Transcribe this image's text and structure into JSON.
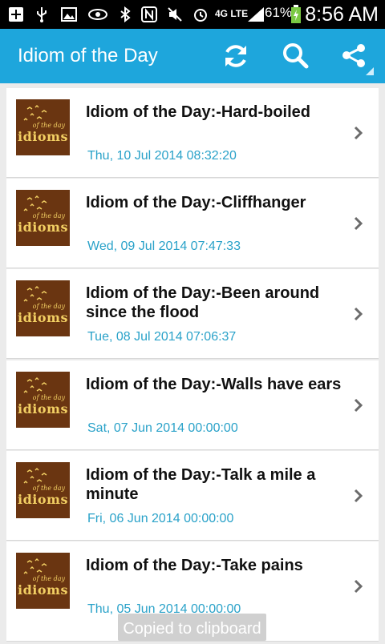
{
  "status_bar": {
    "battery": "61%",
    "network": "4G LTE",
    "time": "8:56 AM"
  },
  "app_bar": {
    "title": "Idiom of the Day",
    "icons": [
      "refresh-icon",
      "search-icon",
      "share-icon"
    ]
  },
  "thumbnail": {
    "logo_text": "idioms",
    "logo_subtext": "of the day"
  },
  "items": [
    {
      "title": "Idiom of the Day:-Hard-boiled",
      "date": "Thu, 10 Jul 2014 08:32:20"
    },
    {
      "title": "Idiom of the Day:-Cliffhanger",
      "date": "Wed, 09 Jul 2014 07:47:33"
    },
    {
      "title": "Idiom of the Day:-Been around since the flood",
      "date": "Tue, 08 Jul 2014 07:06:37"
    },
    {
      "title": "Idiom of the Day:-Walls have ears",
      "date": "Sat, 07 Jun 2014 00:00:00"
    },
    {
      "title": "Idiom of the Day:-Talk a mile a minute",
      "date": "Fri, 06 Jun 2014 00:00:00"
    },
    {
      "title": "Idiom of the Day:-Take pains",
      "date": "Thu, 05 Jun 2014 00:00:00"
    }
  ],
  "toast": "Copied to clipboard",
  "colors": {
    "action_bar": "#1ea6dc",
    "date_text": "#2aa2c9",
    "thumb_bg": "#6a3511",
    "thumb_text": "#f2cf63"
  }
}
